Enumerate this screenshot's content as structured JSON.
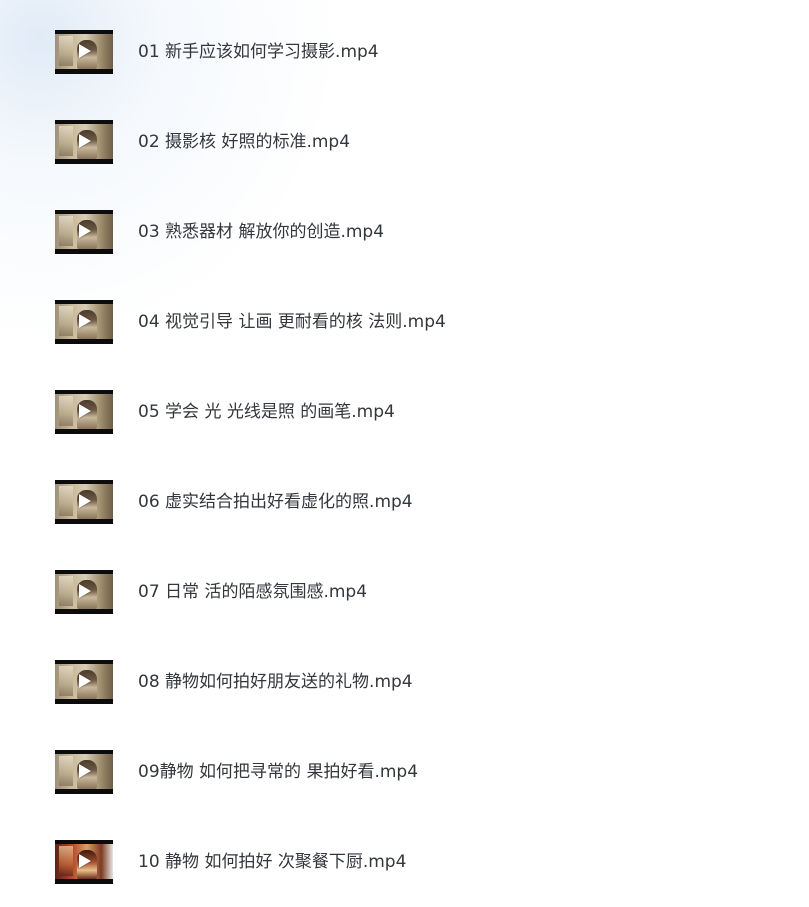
{
  "files": [
    {
      "name": "01 新手应该如何学习摄影.mp4",
      "thumbnail_icon": "video-play-icon"
    },
    {
      "name": "02 摄影核 好照的标准.mp4",
      "thumbnail_icon": "video-play-icon"
    },
    {
      "name": "03 熟悉器材 解放你的创造.mp4",
      "thumbnail_icon": "video-play-icon"
    },
    {
      "name": "04 视觉引导 让画 更耐看的核 法则.mp4",
      "thumbnail_icon": "video-play-icon"
    },
    {
      "name": "05 学会 光 光线是照 的画笔.mp4",
      "thumbnail_icon": "video-play-icon"
    },
    {
      "name": "06 虚实结合拍出好看虚化的照.mp4",
      "thumbnail_icon": "video-play-icon"
    },
    {
      "name": "07 日常 活的陌感氛围感.mp4",
      "thumbnail_icon": "video-play-icon"
    },
    {
      "name": "08 静物如何拍好朋友送的礼物.mp4",
      "thumbnail_icon": "video-play-icon"
    },
    {
      "name": "09静物 如何把寻常的 果拍好看.mp4",
      "thumbnail_icon": "video-play-icon"
    },
    {
      "name": "10 静物 如何拍好 次聚餐下厨.mp4",
      "thumbnail_icon": "video-play-icon"
    }
  ]
}
